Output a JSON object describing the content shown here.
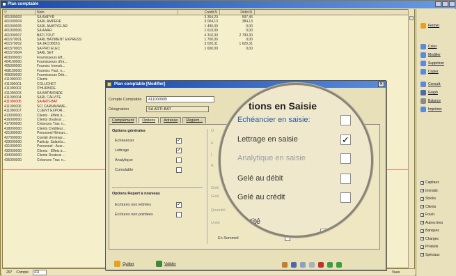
{
  "main_window": {
    "title": "Plan comptable"
  },
  "columns": [
    "Num",
    "Nom",
    "Crédit N",
    "Débit N"
  ],
  "rows": [
    [
      "401000003",
      "SA AMPYR",
      "3 354,23",
      "597,45"
    ],
    [
      "401000004",
      "SARL AMPERE",
      "3 004,13",
      "384,13"
    ],
    [
      "401000005",
      "SARL AMATYELAR",
      "1 490,00",
      "0,00"
    ],
    [
      "401000006",
      "SA AAAFI",
      "1 610,00",
      "0,00"
    ],
    [
      "401000007",
      "BATI-TOUT",
      "4 310,30",
      "2 790,30"
    ],
    [
      "401570001",
      "SARL BATIMENT EXPRESS",
      "1 700,00",
      "0,00"
    ],
    [
      "401570002",
      "SA JACOBDIS",
      "3 020,31",
      "1 620,31"
    ],
    [
      "401570003",
      "SA PRO ELEC",
      "1 600,00",
      "0,00"
    ],
    [
      "401570004",
      "SARL SET",
      "",
      ""
    ],
    [
      "403000000",
      "Fournisseurs Eff...",
      "",
      ""
    ],
    [
      "404100000",
      "Fournisseurs d'im...",
      "",
      ""
    ],
    [
      "405000000",
      "Fournisr. Immob...",
      "",
      ""
    ],
    [
      "408100000",
      "Fournisr. Fact. n...",
      "",
      ""
    ],
    [
      "409000000",
      "Fournisseurs Déb...",
      "",
      ""
    ],
    [
      "411000000",
      "Clients",
      "",
      ""
    ],
    [
      "411000001",
      "COLUCHET",
      "",
      ""
    ],
    [
      "411000002",
      "ITHURBIDE",
      "",
      ""
    ],
    [
      "411000003",
      "SA BATIMONDE",
      "",
      ""
    ],
    [
      "411000004",
      "SARL CALVITE",
      "",
      ""
    ],
    [
      "411000005",
      "SA ARTI-BAT",
      "",
      ""
    ],
    [
      "411000006",
      "SCI CARNAVAME...",
      "",
      ""
    ],
    [
      "411000007",
      "CLIENT EXPOR...",
      "",
      ""
    ],
    [
      "413000000",
      "Clients - Effets à ...",
      "",
      ""
    ],
    [
      "416000000",
      "Clients Douteux ...",
      "",
      ""
    ],
    [
      "417000000",
      "Créances Trav. n...",
      "",
      ""
    ],
    [
      "418000000",
      "Clients Créditeur...",
      "",
      ""
    ],
    [
      "421000000",
      "Personnel Rémun...",
      "",
      ""
    ],
    [
      "427000000",
      "Comité d'entrepr...",
      "",
      ""
    ],
    [
      "429000000",
      "Particip. Salariés...",
      "",
      ""
    ],
    [
      "431000000",
      "Personnel - Avar...",
      "",
      ""
    ],
    [
      "432000000",
      "Clients - Effets à ...",
      "",
      ""
    ],
    [
      "434000000",
      "Clients Douteux ...",
      "",
      ""
    ],
    [
      "435000000",
      "Créances Trav. n...",
      "",
      ""
    ]
  ],
  "status": {
    "count": "297",
    "label": "Compte",
    "value": "411",
    "view": "Vues"
  },
  "right_panel": {
    "buttons": [
      "Fermer",
      "Créer",
      "Modifier",
      "Supprimer",
      "Copier",
      "Consult.",
      "Graph",
      "Balance",
      "Imprimer"
    ],
    "checks": [
      {
        "label": "Capitaux",
        "checked": true
      },
      {
        "label": "Immobil.",
        "checked": true
      },
      {
        "label": "Stocks",
        "checked": true
      },
      {
        "label": "Clients",
        "checked": true
      },
      {
        "label": "Fourn.",
        "checked": true
      },
      {
        "label": "Autres tiers",
        "checked": true
      },
      {
        "label": "Banques",
        "checked": true
      },
      {
        "label": "Charges",
        "checked": true
      },
      {
        "label": "Produits",
        "checked": true
      },
      {
        "label": "Spéciaux",
        "checked": true
      }
    ]
  },
  "dialog": {
    "title": "Plan comptable [Modifier]",
    "account_label": "Compte Comptable",
    "account_value": "411000005",
    "designation_label": "Désignation",
    "designation_value": "SA ARTI-BAT",
    "tabs": [
      "Complément",
      "Options",
      "Adresse",
      "Règlem..."
    ],
    "general_title": "Options générales",
    "general": [
      {
        "label": "Echéancier",
        "checked": true
      },
      {
        "label": "Lettrage",
        "checked": true
      },
      {
        "label": "Analytique",
        "checked": false
      },
      {
        "label": "Cumulable",
        "checked": false
      }
    ],
    "report_title": "Options Report à nouveau",
    "report": [
      {
        "label": "Ecritures non lettrées",
        "checked": true
      },
      {
        "label": "Ecritures non pointées",
        "checked": false
      }
    ],
    "right_labels": [
      "O",
      "E",
      "L",
      "A",
      "Gelé",
      "Gelé",
      "Quantité",
      "Unité"
    ],
    "en_sommeil": "En Sommeil",
    "quit": "Quitter",
    "validate": "Valider"
  },
  "magnifier": {
    "title": "tions en Saisie",
    "rows": [
      {
        "label": "Echéancier en saisie:",
        "checked": false,
        "style": "blue"
      },
      {
        "label": "Lettrage en saisie",
        "checked": true,
        "style": "normal"
      },
      {
        "label": "Analytique en saisie",
        "checked": false,
        "style": "dis"
      },
      {
        "label": "Gelé au débit",
        "checked": false,
        "style": "normal"
      },
      {
        "label": "Gelé au crédit",
        "checked": false,
        "style": "normal"
      },
      {
        "label": "uantité",
        "checked": null,
        "style": "normal"
      }
    ]
  }
}
